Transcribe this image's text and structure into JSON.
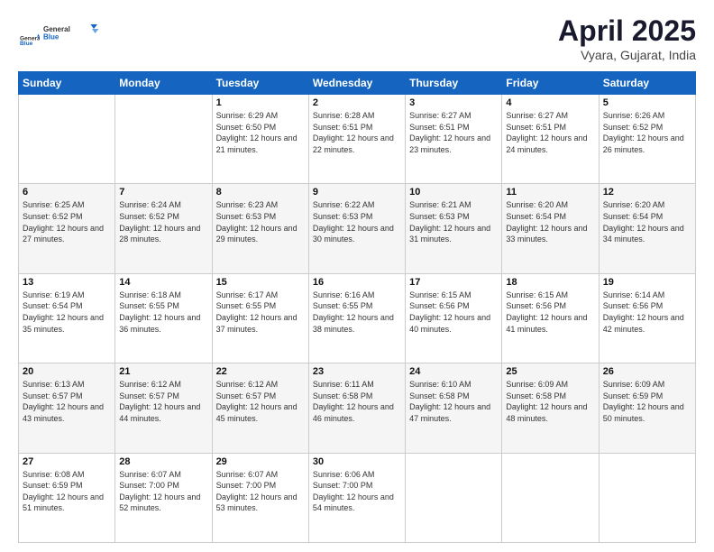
{
  "logo": {
    "general": "General",
    "blue": "Blue"
  },
  "title": {
    "month": "April 2025",
    "location": "Vyara, Gujarat, India"
  },
  "header_days": [
    "Sunday",
    "Monday",
    "Tuesday",
    "Wednesday",
    "Thursday",
    "Friday",
    "Saturday"
  ],
  "weeks": [
    [
      {
        "day": "",
        "sunrise": "",
        "sunset": "",
        "daylight": ""
      },
      {
        "day": "",
        "sunrise": "",
        "sunset": "",
        "daylight": ""
      },
      {
        "day": "1",
        "sunrise": "Sunrise: 6:29 AM",
        "sunset": "Sunset: 6:50 PM",
        "daylight": "Daylight: 12 hours and 21 minutes."
      },
      {
        "day": "2",
        "sunrise": "Sunrise: 6:28 AM",
        "sunset": "Sunset: 6:51 PM",
        "daylight": "Daylight: 12 hours and 22 minutes."
      },
      {
        "day": "3",
        "sunrise": "Sunrise: 6:27 AM",
        "sunset": "Sunset: 6:51 PM",
        "daylight": "Daylight: 12 hours and 23 minutes."
      },
      {
        "day": "4",
        "sunrise": "Sunrise: 6:27 AM",
        "sunset": "Sunset: 6:51 PM",
        "daylight": "Daylight: 12 hours and 24 minutes."
      },
      {
        "day": "5",
        "sunrise": "Sunrise: 6:26 AM",
        "sunset": "Sunset: 6:52 PM",
        "daylight": "Daylight: 12 hours and 26 minutes."
      }
    ],
    [
      {
        "day": "6",
        "sunrise": "Sunrise: 6:25 AM",
        "sunset": "Sunset: 6:52 PM",
        "daylight": "Daylight: 12 hours and 27 minutes."
      },
      {
        "day": "7",
        "sunrise": "Sunrise: 6:24 AM",
        "sunset": "Sunset: 6:52 PM",
        "daylight": "Daylight: 12 hours and 28 minutes."
      },
      {
        "day": "8",
        "sunrise": "Sunrise: 6:23 AM",
        "sunset": "Sunset: 6:53 PM",
        "daylight": "Daylight: 12 hours and 29 minutes."
      },
      {
        "day": "9",
        "sunrise": "Sunrise: 6:22 AM",
        "sunset": "Sunset: 6:53 PM",
        "daylight": "Daylight: 12 hours and 30 minutes."
      },
      {
        "day": "10",
        "sunrise": "Sunrise: 6:21 AM",
        "sunset": "Sunset: 6:53 PM",
        "daylight": "Daylight: 12 hours and 31 minutes."
      },
      {
        "day": "11",
        "sunrise": "Sunrise: 6:20 AM",
        "sunset": "Sunset: 6:54 PM",
        "daylight": "Daylight: 12 hours and 33 minutes."
      },
      {
        "day": "12",
        "sunrise": "Sunrise: 6:20 AM",
        "sunset": "Sunset: 6:54 PM",
        "daylight": "Daylight: 12 hours and 34 minutes."
      }
    ],
    [
      {
        "day": "13",
        "sunrise": "Sunrise: 6:19 AM",
        "sunset": "Sunset: 6:54 PM",
        "daylight": "Daylight: 12 hours and 35 minutes."
      },
      {
        "day": "14",
        "sunrise": "Sunrise: 6:18 AM",
        "sunset": "Sunset: 6:55 PM",
        "daylight": "Daylight: 12 hours and 36 minutes."
      },
      {
        "day": "15",
        "sunrise": "Sunrise: 6:17 AM",
        "sunset": "Sunset: 6:55 PM",
        "daylight": "Daylight: 12 hours and 37 minutes."
      },
      {
        "day": "16",
        "sunrise": "Sunrise: 6:16 AM",
        "sunset": "Sunset: 6:55 PM",
        "daylight": "Daylight: 12 hours and 38 minutes."
      },
      {
        "day": "17",
        "sunrise": "Sunrise: 6:15 AM",
        "sunset": "Sunset: 6:56 PM",
        "daylight": "Daylight: 12 hours and 40 minutes."
      },
      {
        "day": "18",
        "sunrise": "Sunrise: 6:15 AM",
        "sunset": "Sunset: 6:56 PM",
        "daylight": "Daylight: 12 hours and 41 minutes."
      },
      {
        "day": "19",
        "sunrise": "Sunrise: 6:14 AM",
        "sunset": "Sunset: 6:56 PM",
        "daylight": "Daylight: 12 hours and 42 minutes."
      }
    ],
    [
      {
        "day": "20",
        "sunrise": "Sunrise: 6:13 AM",
        "sunset": "Sunset: 6:57 PM",
        "daylight": "Daylight: 12 hours and 43 minutes."
      },
      {
        "day": "21",
        "sunrise": "Sunrise: 6:12 AM",
        "sunset": "Sunset: 6:57 PM",
        "daylight": "Daylight: 12 hours and 44 minutes."
      },
      {
        "day": "22",
        "sunrise": "Sunrise: 6:12 AM",
        "sunset": "Sunset: 6:57 PM",
        "daylight": "Daylight: 12 hours and 45 minutes."
      },
      {
        "day": "23",
        "sunrise": "Sunrise: 6:11 AM",
        "sunset": "Sunset: 6:58 PM",
        "daylight": "Daylight: 12 hours and 46 minutes."
      },
      {
        "day": "24",
        "sunrise": "Sunrise: 6:10 AM",
        "sunset": "Sunset: 6:58 PM",
        "daylight": "Daylight: 12 hours and 47 minutes."
      },
      {
        "day": "25",
        "sunrise": "Sunrise: 6:09 AM",
        "sunset": "Sunset: 6:58 PM",
        "daylight": "Daylight: 12 hours and 48 minutes."
      },
      {
        "day": "26",
        "sunrise": "Sunrise: 6:09 AM",
        "sunset": "Sunset: 6:59 PM",
        "daylight": "Daylight: 12 hours and 50 minutes."
      }
    ],
    [
      {
        "day": "27",
        "sunrise": "Sunrise: 6:08 AM",
        "sunset": "Sunset: 6:59 PM",
        "daylight": "Daylight: 12 hours and 51 minutes."
      },
      {
        "day": "28",
        "sunrise": "Sunrise: 6:07 AM",
        "sunset": "Sunset: 7:00 PM",
        "daylight": "Daylight: 12 hours and 52 minutes."
      },
      {
        "day": "29",
        "sunrise": "Sunrise: 6:07 AM",
        "sunset": "Sunset: 7:00 PM",
        "daylight": "Daylight: 12 hours and 53 minutes."
      },
      {
        "day": "30",
        "sunrise": "Sunrise: 6:06 AM",
        "sunset": "Sunset: 7:00 PM",
        "daylight": "Daylight: 12 hours and 54 minutes."
      },
      {
        "day": "",
        "sunrise": "",
        "sunset": "",
        "daylight": ""
      },
      {
        "day": "",
        "sunrise": "",
        "sunset": "",
        "daylight": ""
      },
      {
        "day": "",
        "sunrise": "",
        "sunset": "",
        "daylight": ""
      }
    ]
  ]
}
